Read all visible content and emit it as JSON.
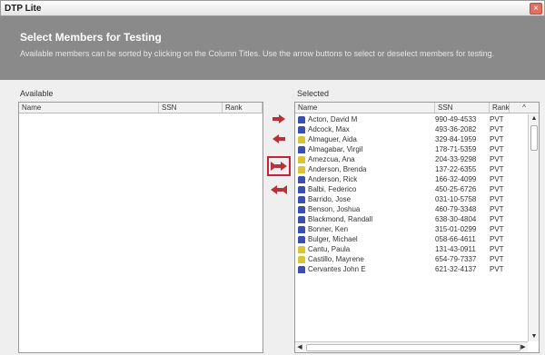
{
  "window": {
    "title": "DTP Lite",
    "close_glyph": "×"
  },
  "header": {
    "heading": "Select Members for Testing",
    "description": "Available members can be sorted by clicking on the Column Titles. Use the arrow buttons to select or deselect members for testing."
  },
  "available": {
    "label": "Available",
    "columns": {
      "name": "Name",
      "ssn": "SSN",
      "rank": "Rank"
    },
    "rows": []
  },
  "selected": {
    "label": "Selected",
    "columns": {
      "name": "Name",
      "ssn": "SSN",
      "rank": "Rank"
    },
    "rows": [
      {
        "name": "Acton, David M",
        "ssn": "990-49-4533",
        "rank": "PVT",
        "icon": "blue"
      },
      {
        "name": "Adcock, Max",
        "ssn": "493-36-2082",
        "rank": "PVT",
        "icon": "blue"
      },
      {
        "name": "Almaguer, Aida",
        "ssn": "329-84-1959",
        "rank": "PVT",
        "icon": "yellow"
      },
      {
        "name": "Almagabar, Virgil",
        "ssn": "178-71-5359",
        "rank": "PVT",
        "icon": "blue"
      },
      {
        "name": "Amezcua, Ana",
        "ssn": "204-33-9298",
        "rank": "PVT",
        "icon": "yellow"
      },
      {
        "name": "Anderson, Brenda",
        "ssn": "137-22-6355",
        "rank": "PVT",
        "icon": "yellow"
      },
      {
        "name": "Anderson, Rick",
        "ssn": "166-32-4099",
        "rank": "PVT",
        "icon": "blue"
      },
      {
        "name": "Balbi, Federico",
        "ssn": "450-25-6726",
        "rank": "PVT",
        "icon": "blue"
      },
      {
        "name": "Barrido, Jose",
        "ssn": "031-10-5758",
        "rank": "PVT",
        "icon": "blue"
      },
      {
        "name": "Benson, Joshua",
        "ssn": "460-79-3348",
        "rank": "PVT",
        "icon": "blue"
      },
      {
        "name": "Blackmond, Randall",
        "ssn": "638-30-4804",
        "rank": "PVT",
        "icon": "blue"
      },
      {
        "name": "Bonner, Ken",
        "ssn": "315-01-0299",
        "rank": "PVT",
        "icon": "blue"
      },
      {
        "name": "Bulger, Michael",
        "ssn": "058-66-4611",
        "rank": "PVT",
        "icon": "blue"
      },
      {
        "name": "Cantu, Paula",
        "ssn": "131-43-0911",
        "rank": "PVT",
        "icon": "yellow"
      },
      {
        "name": "Castillo, Mayrene",
        "ssn": "654-79-7337",
        "rank": "PVT",
        "icon": "yellow"
      },
      {
        "name": "Cervantes John E",
        "ssn": "621-32-4137",
        "rank": "PVT",
        "icon": "blue"
      }
    ]
  },
  "icons": {
    "arrow_color": "#b8323a",
    "highlight_color": "#c4213d",
    "member_blue": "#3a4fb0",
    "member_yellow": "#d9c437"
  }
}
